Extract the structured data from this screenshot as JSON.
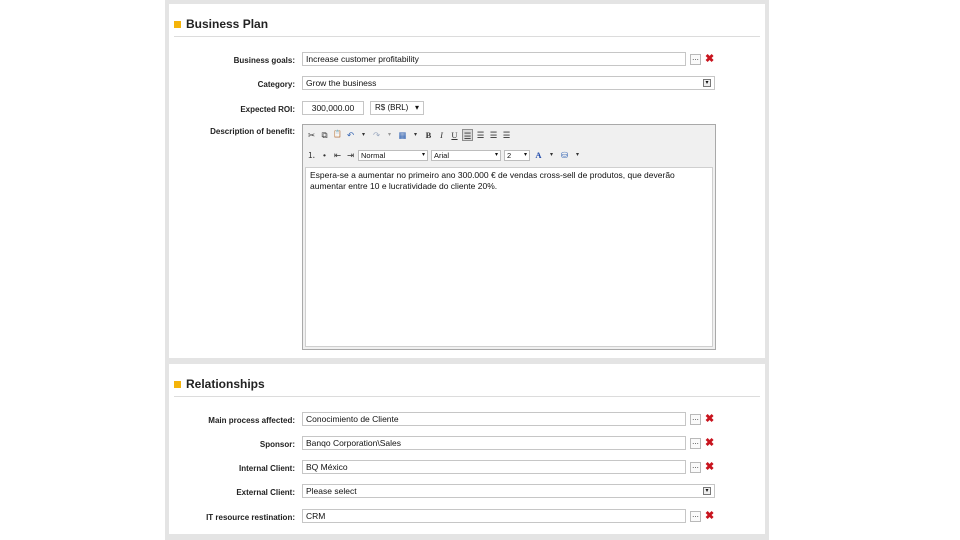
{
  "business_plan": {
    "title": "Business Plan",
    "business_goals": {
      "label": "Business goals:",
      "value": "Increase customer profitability"
    },
    "category": {
      "label": "Category:",
      "value": "Grow the business"
    },
    "expected_roi": {
      "label": "Expected ROI:",
      "value": "300,000.00",
      "currency": "R$ (BRL)"
    },
    "description": {
      "label": "Description of benefit:",
      "toolbar": {
        "cut": "✂",
        "copy": "⧉",
        "paste": "📋",
        "undo": "↶",
        "redo": "↷",
        "table": "▦",
        "bold": "B",
        "italic": "I",
        "underline": "U",
        "align_left": "☰",
        "align_center": "☰",
        "align_right": "☰",
        "justify": "☰",
        "ordered_list": "⒈",
        "unordered_list": "•",
        "outdent": "⇤",
        "indent": "⇥",
        "format": "Normal",
        "font": "Arial",
        "size": "2",
        "font_color": "A",
        "bg_color": "⛁"
      },
      "text": "Espera-se a aumentar no primeiro ano 300.000 € de vendas cross-sell de produtos, que deverão aumentar entre 10 e lucratividade do cliente 20%."
    }
  },
  "relationships": {
    "title": "Relationships",
    "main_process": {
      "label": "Main process affected:",
      "value": "Conocimiento de Cliente"
    },
    "sponsor": {
      "label": "Sponsor:",
      "value": "Banqo Corporation\\Sales"
    },
    "internal_client": {
      "label": "Internal Client:",
      "value": "BQ México"
    },
    "external_client": {
      "label": "External Client:",
      "value": "Please select"
    },
    "it_resource": {
      "label": "IT resource restination:",
      "value": "CRM"
    }
  },
  "icons": {
    "dots": "...",
    "delete": "✖",
    "dropdown": "▾"
  },
  "colors": {
    "section_bullet": "#f5b40a",
    "delete_icon": "#c8141e"
  }
}
